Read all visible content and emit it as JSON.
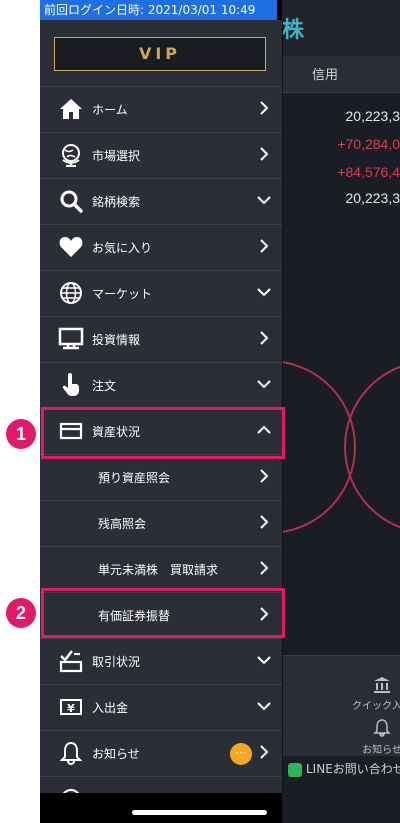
{
  "status_bar": {
    "last_login": "前回ログイン日時: 2021/03/01 10:49"
  },
  "drawer": {
    "vip_label": "VIP",
    "items": [
      {
        "label": "ホーム",
        "icon": "home-icon",
        "chevron": "right"
      },
      {
        "label": "市場選択",
        "icon": "globe-stand-icon",
        "chevron": "right"
      },
      {
        "label": "銘柄検索",
        "icon": "search-icon",
        "chevron": "down"
      },
      {
        "label": "お気に入り",
        "icon": "heart-icon",
        "chevron": "right"
      },
      {
        "label": "マーケット",
        "icon": "globe-icon",
        "chevron": "down"
      },
      {
        "label": "投資情報",
        "icon": "monitor-icon",
        "chevron": "right"
      },
      {
        "label": "注文",
        "icon": "tap-hand-icon",
        "chevron": "down"
      },
      {
        "label": "資産状況",
        "icon": "card-icon",
        "chevron": "up"
      },
      {
        "label": "預り資産照会",
        "icon": "",
        "chevron": "right"
      },
      {
        "label": "残高照会",
        "icon": "",
        "chevron": "right"
      },
      {
        "label": "単元未満株　買取請求",
        "icon": "",
        "chevron": "right"
      },
      {
        "label": "有価証券振替",
        "icon": "",
        "chevron": "right"
      },
      {
        "label": "取引状況",
        "icon": "checklist-icon",
        "chevron": "down"
      },
      {
        "label": "入出金",
        "icon": "yen-icon",
        "chevron": "down"
      },
      {
        "label": "お知らせ",
        "icon": "bell-icon",
        "chevron": "right",
        "badge": "···"
      }
    ]
  },
  "annotations": {
    "marker1": "1",
    "marker2": "2"
  },
  "background": {
    "title_fragment": "株",
    "tab_label": "信用",
    "values": [
      "20,223,3",
      "+70,284,0",
      "+84,576,4",
      "20,223,3"
    ],
    "quick_label": "クイック入金",
    "notice_label": "お知らせ",
    "line_label": "LINEお問い合わせ"
  },
  "colors": {
    "accent": "#e01a6b",
    "drawer_bg": "#2b2e36",
    "vip_gold": "#cda65c",
    "status_blue": "#1f6fe0",
    "badge_orange": "#f5a623"
  }
}
